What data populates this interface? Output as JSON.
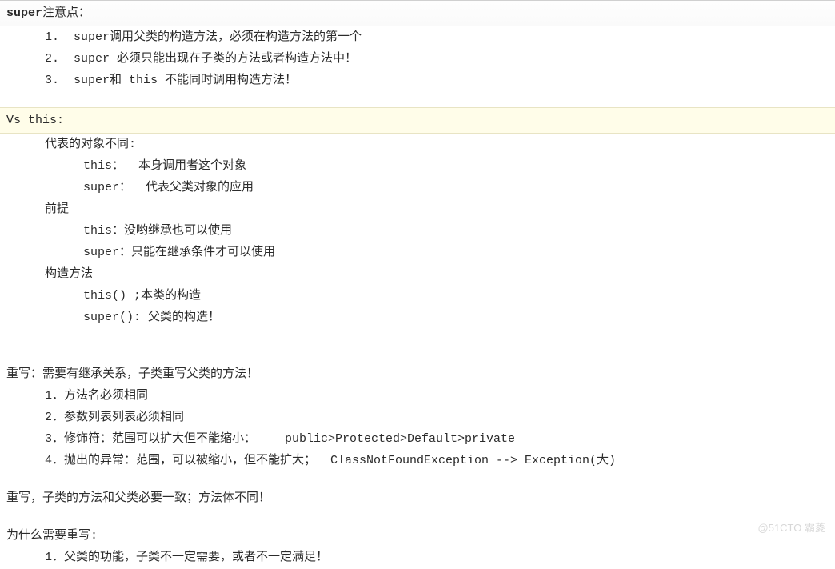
{
  "section1": {
    "title": "super注意点：",
    "items": [
      "1.  super调用父类的构造方法，必须在构造方法的第一个",
      "2.  super 必须只能出现在子类的方法或者构造方法中！",
      "3.  super和 this 不能同时调用构造方法！"
    ]
  },
  "section2": {
    "title": "Vs this:",
    "group1": {
      "heading": "代表的对象不同:",
      "items": [
        "this：  本身调用者这个对象",
        "super：  代表父类对象的应用"
      ]
    },
    "group2": {
      "heading": "前提",
      "items": [
        "this：没哟继承也可以使用",
        "super：只能在继承条件才可以使用"
      ]
    },
    "group3": {
      "heading": "构造方法",
      "items": [
        "this() ;本类的构造",
        "super(): 父类的构造！"
      ]
    }
  },
  "section3": {
    "title": "重写：需要有继承关系，子类重写父类的方法！",
    "items": [
      "1．方法名必须相同",
      "2．参数列表列表必须相同",
      "3．修饰符：范围可以扩大但不能缩小：    public>Protected>Default>private",
      "4．抛出的异常：范围，可以被缩小，但不能扩大；  ClassNotFoundException --> Exception(大)"
    ]
  },
  "section4": {
    "line": "重写，子类的方法和父类必要一致；方法体不同！"
  },
  "section5": {
    "title": "为什么需要重写:",
    "items": [
      "1．父类的功能，子类不一定需要，或者不一定满足！"
    ]
  },
  "watermark": "@51CTO 霸菱"
}
